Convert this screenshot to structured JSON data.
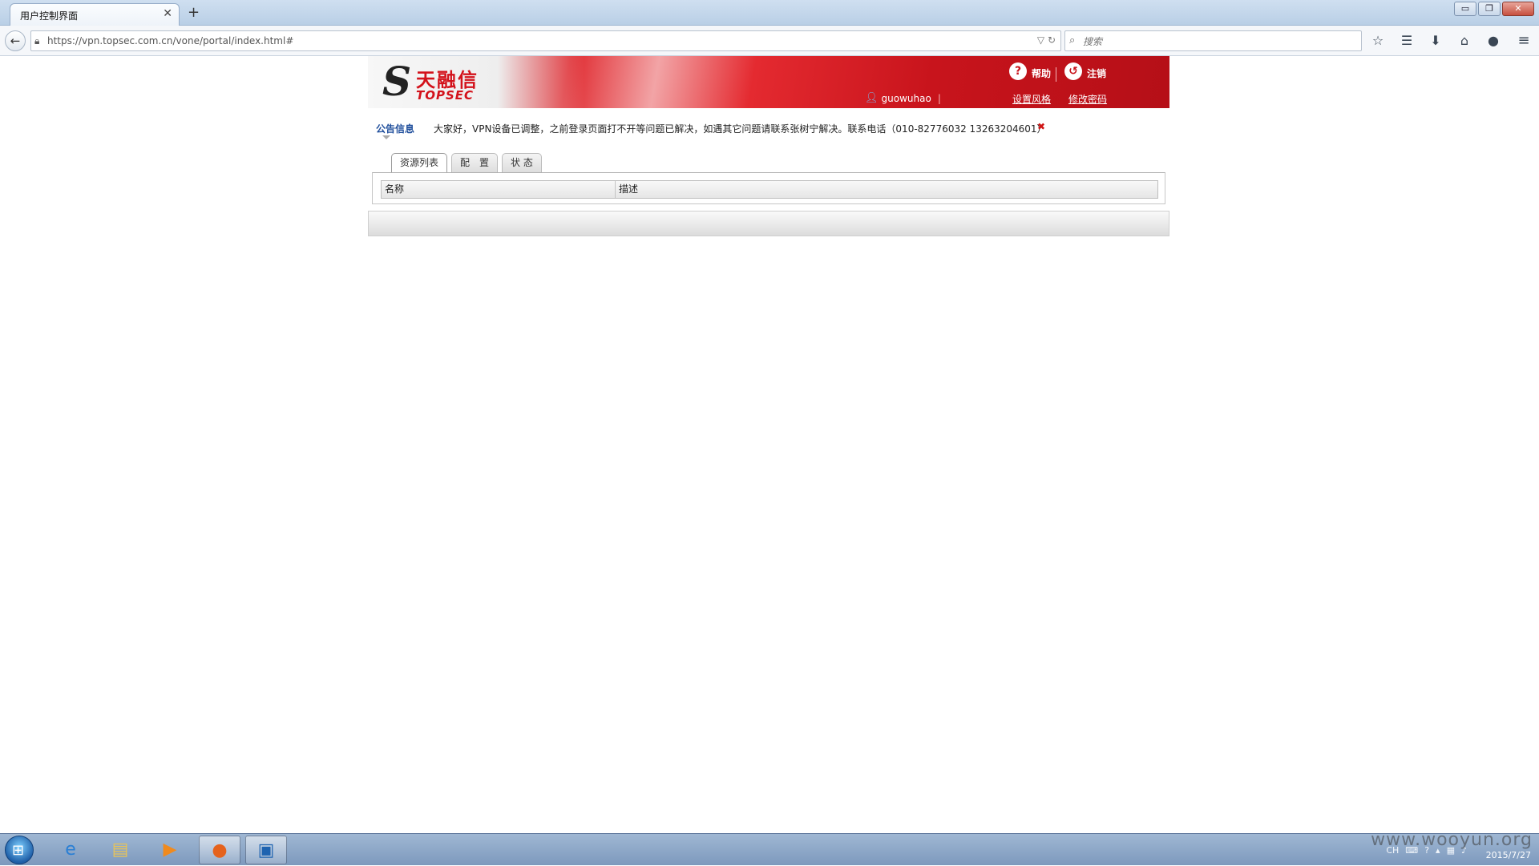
{
  "browser": {
    "tab_title": "用户控制界面",
    "tab_close": "✕",
    "new_tab": "+",
    "url": "https://vpn.topsec.com.cn/vone/portal/index.html#",
    "search_placeholder": "搜索",
    "window_controls": {
      "minimize": "▭",
      "restore": "❐",
      "close": "✕"
    }
  },
  "portal": {
    "logo": {
      "mark": "S",
      "cn": "天融信",
      "en": "TOPSEC"
    },
    "header": {
      "help_label": "帮助",
      "logout_label": "注销",
      "username": "guowuhao",
      "set_style_link": "设置风格",
      "change_password_link": "修改密码"
    },
    "notice": {
      "label": "公告信息",
      "text": "大家好，VPN设备已调整，之前登录页面打不开等问题已解决，如遇其它问题请联系张树宁解决。联系电话（010-82776032 13263204601）",
      "close": "✖"
    },
    "tabs": [
      {
        "label": "资源列表",
        "active": true
      },
      {
        "label": "配　置",
        "active": false
      },
      {
        "label": "状 态",
        "active": false
      }
    ],
    "table": {
      "columns": [
        "名称",
        "描述"
      ]
    }
  },
  "taskbar": {
    "apps": [
      "ie-icon",
      "explorer-icon",
      "media-player-icon",
      "firefox-icon",
      "vm-icon"
    ],
    "tray": {
      "lang": "CH"
    },
    "clock": {
      "date": "2015/7/27"
    }
  },
  "watermark": "www.wooyun.org",
  "colors": {
    "banner_red": "#c8141c",
    "notice_label": "#1f4e9c",
    "close_red": "#d01515"
  }
}
